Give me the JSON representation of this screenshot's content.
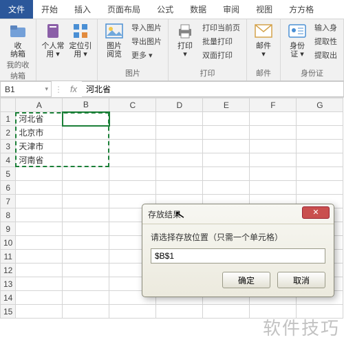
{
  "tabs": {
    "file": "文件",
    "home": "开始",
    "insert": "插入",
    "layout": "页面布局",
    "formula": "公式",
    "data": "数据",
    "review": "审阅",
    "view": "视图",
    "toolbox": "方方格"
  },
  "ribbon": {
    "g1": {
      "btn1": "收\n纳箱",
      "label": "我的收纳箱"
    },
    "g2": {
      "btn1": "个人常\n用 ▾",
      "btn2": "定位引\n用 ▾"
    },
    "g3": {
      "btn1": "图片\n阅览",
      "m1": "导入图片",
      "m2": "导出图片",
      "m3": "更多 ▾",
      "label": "图片"
    },
    "g4": {
      "btn1": "打印\n▾",
      "m1": "打印当前页",
      "m2": "批量打印",
      "m3": "双面打印",
      "label": "打印"
    },
    "g5": {
      "btn1": "邮件\n▾",
      "label": "邮件"
    },
    "g6": {
      "btn1": "身份\n证 ▾",
      "m1": "输入身",
      "m2": "提取性",
      "m3": "提取出",
      "label": "身份证"
    }
  },
  "qat": "",
  "namebox": "B1",
  "fx": "河北省",
  "cells": {
    "a1": "河北省",
    "a2": "北京市",
    "a3": "天津市",
    "a4": "河南省"
  },
  "cols": [
    "A",
    "B",
    "C",
    "D",
    "E",
    "F",
    "G"
  ],
  "rows": [
    "1",
    "2",
    "3",
    "4",
    "5",
    "6",
    "7",
    "8",
    "9",
    "10",
    "11",
    "12",
    "13",
    "14",
    "15"
  ],
  "dialog": {
    "title": "存放结果",
    "label": "请选择存放位置（只需一个单元格）",
    "value": "$B$1",
    "ok": "确定",
    "cancel": "取消",
    "close": "✕"
  },
  "watermark": "软件技巧"
}
